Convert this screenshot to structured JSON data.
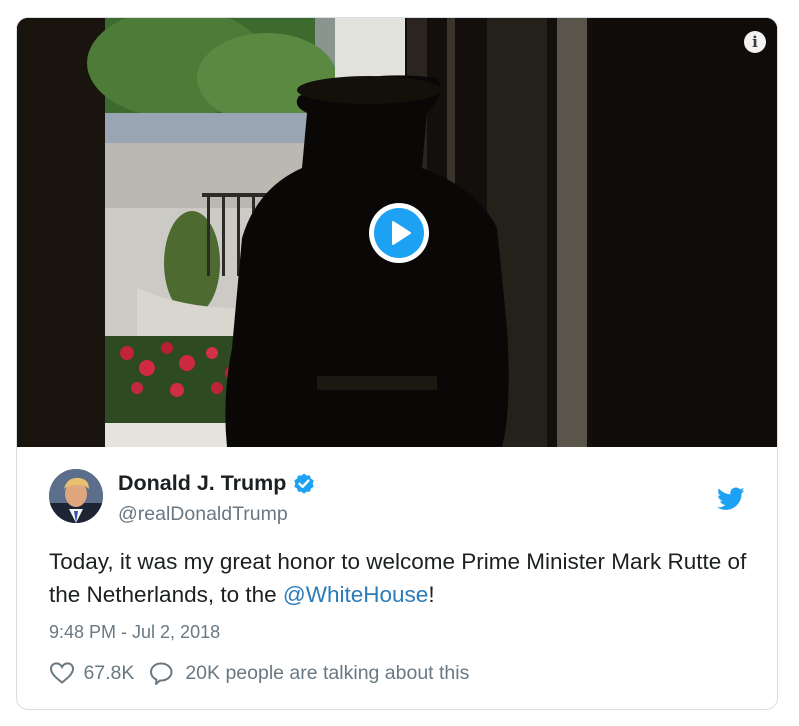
{
  "media": {
    "play_icon": "play-icon",
    "info_icon": "info-icon",
    "info_glyph": "i"
  },
  "author": {
    "display_name": "Donald J. Trump",
    "handle": "@realDonaldTrump",
    "verified": true
  },
  "tweet": {
    "text_before_mention": "Today, it was my great honor to welcome Prime Minister Mark Rutte of the Netherlands, to the ",
    "mention": "@WhiteHouse",
    "text_after_mention": "!",
    "timestamp": "9:48 PM - Jul 2, 2018"
  },
  "actions": {
    "likes": "67.8K",
    "talking": "20K people are talking about this"
  },
  "colors": {
    "accent": "#1da1f2",
    "link": "#2b7bb9",
    "secondary_text": "#697882",
    "primary_text": "#1c2022",
    "border": "#d8dde1"
  }
}
